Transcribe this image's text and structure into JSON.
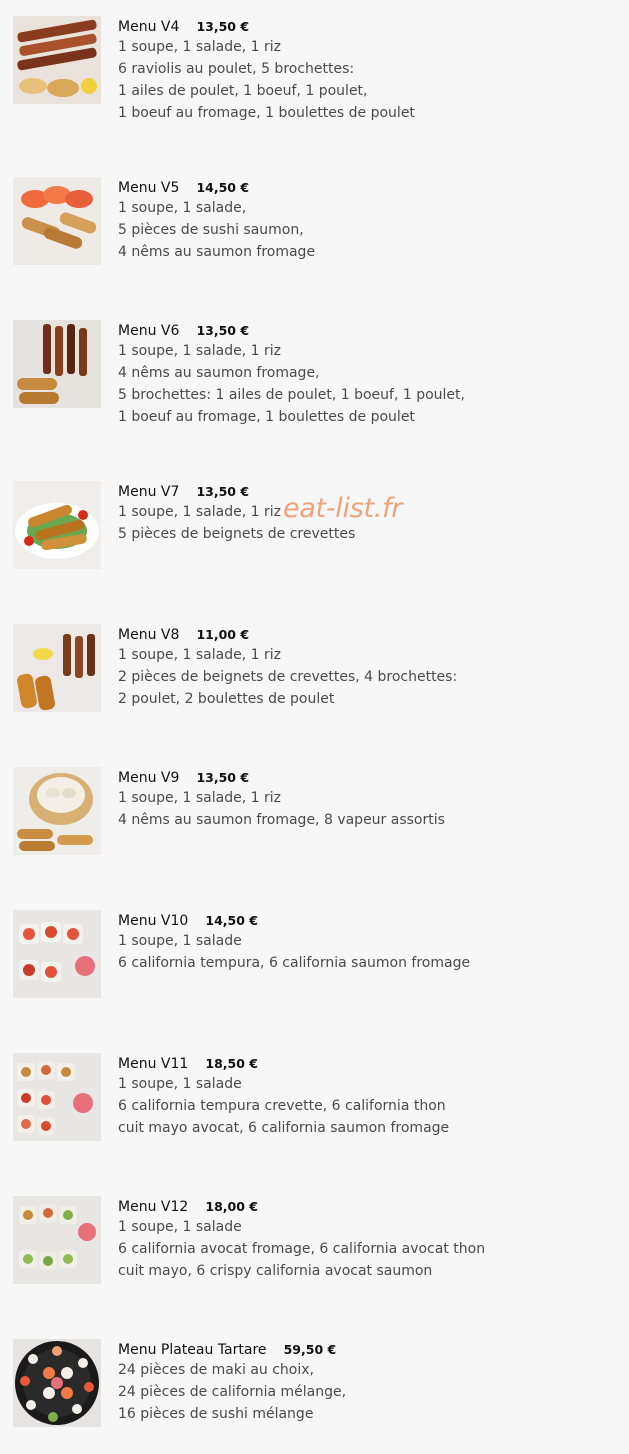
{
  "watermark": "eat-list.fr",
  "items": [
    {
      "name": "Menu V4",
      "price": "13,50 €",
      "lines": [
        "1 soupe, 1 salade, 1 riz",
        "6 raviolis au poulet, 5 brochettes:",
        "1 ailes de poulet, 1 boeuf, 1 poulet,",
        "1 boeuf au fromage, 1 boulettes de poulet",
        ""
      ]
    },
    {
      "name": "Menu V5",
      "price": "14,50 €",
      "lines": [
        "1 soupe, 1 salade,",
        "5 pièces de sushi saumon,",
        "4 nêms au saumon fromage",
        "",
        ""
      ]
    },
    {
      "name": "Menu V6",
      "price": "13,50 €",
      "lines": [
        "1 soupe, 1 salade, 1 riz",
        "4 nêms au saumon fromage,",
        "5 brochettes: 1 ailes de poulet, 1 boeuf, 1 poulet,",
        "1 boeuf au fromage, 1 boulettes de poulet",
        ""
      ]
    },
    {
      "name": "Menu V7",
      "price": "13,50 €",
      "lines": [
        "1 soupe, 1 salade, 1 riz",
        "5 pièces de beignets de crevettes",
        "",
        "",
        ""
      ]
    },
    {
      "name": "Menu V8",
      "price": "11,00 €",
      "lines": [
        "1 soupe, 1 salade, 1 riz",
        "2 pièces de beignets de crevettes, 4 brochettes:",
        "2 poulet, 2 boulettes de poulet",
        "",
        ""
      ]
    },
    {
      "name": "Menu V9",
      "price": "13,50 €",
      "lines": [
        "1 soupe, 1 salade, 1 riz",
        "4 nêms au saumon fromage, 8 vapeur assortis",
        "",
        "",
        ""
      ]
    },
    {
      "name": "Menu V10",
      "price": "14,50 €",
      "lines": [
        "1 soupe, 1 salade",
        "6 california tempura, 6 california saumon fromage",
        "",
        "",
        ""
      ]
    },
    {
      "name": "Menu V11",
      "price": "18,50 €",
      "lines": [
        "1 soupe, 1 salade",
        "6 california tempura crevette, 6 california thon",
        "cuit mayo avocat, 6 california saumon fromage",
        "",
        ""
      ]
    },
    {
      "name": "Menu V12",
      "price": "18,00 €",
      "lines": [
        "1 soupe, 1 salade",
        "6 california avocat fromage, 6 california avocat thon",
        "cuit mayo, 6 crispy california avocat saumon",
        "",
        ""
      ]
    },
    {
      "name": "Menu Plateau Tartare",
      "price": "59,50 €",
      "lines": [
        "24 pièces de maki au choix,",
        "24 pièces de california mélange,",
        "16 pièces de sushi mélange",
        "",
        ""
      ]
    }
  ]
}
